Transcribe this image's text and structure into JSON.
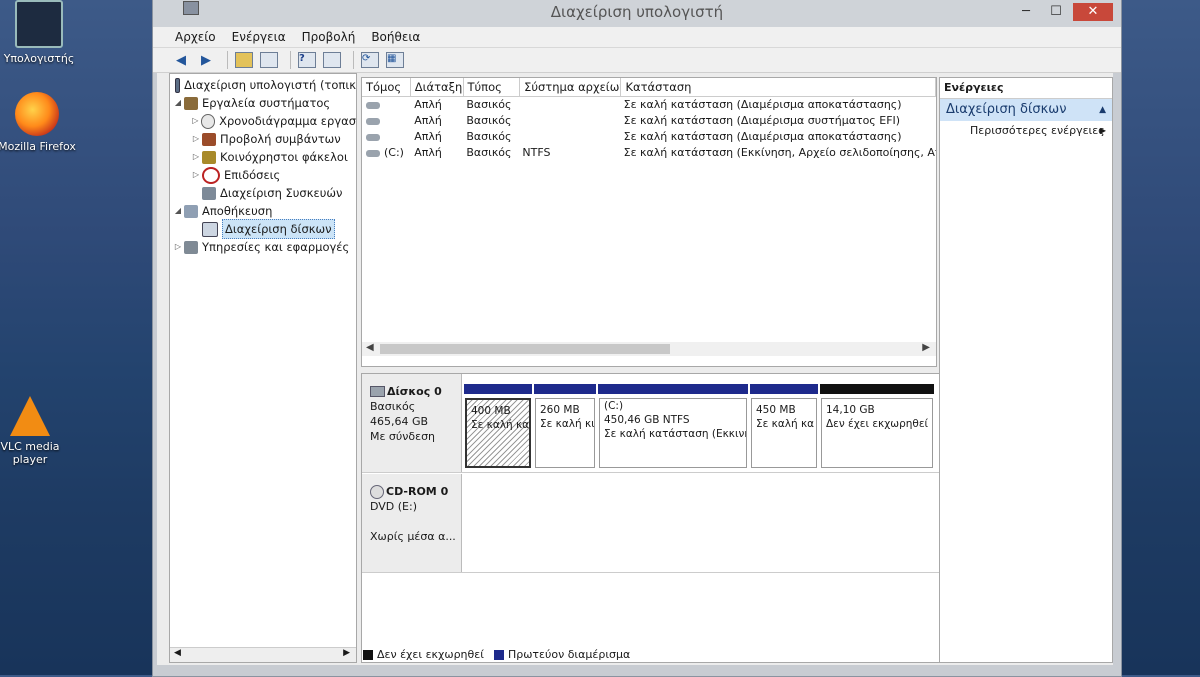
{
  "desktop": {
    "icons": [
      {
        "label": "Υπολογιστής"
      },
      {
        "label": "Mozilla Firefox"
      },
      {
        "label": "VLC media player"
      }
    ]
  },
  "window": {
    "title": "Διαχείριση υπολογιστή",
    "controls": {
      "minimize": "─",
      "maximize": "☐",
      "close": "✕"
    }
  },
  "menu": [
    "Αρχείο",
    "Ενέργεια",
    "Προβολή",
    "Βοήθεια"
  ],
  "tree": {
    "items": [
      {
        "label": "Διαχείριση υπολογιστή (τοπικ",
        "level": 0,
        "arrow": ""
      },
      {
        "label": "Εργαλεία συστήματος",
        "level": 1,
        "arrow": "◢"
      },
      {
        "label": "Χρονοδιάγραμμα εργασ",
        "level": 2,
        "arrow": "▷"
      },
      {
        "label": "Προβολή συμβάντων",
        "level": 2,
        "arrow": "▷"
      },
      {
        "label": "Κοινόχρηστοι φάκελοι",
        "level": 2,
        "arrow": "▷"
      },
      {
        "label": "Επιδόσεις",
        "level": 2,
        "arrow": "▷"
      },
      {
        "label": "Διαχείριση Συσκευών",
        "level": 2,
        "arrow": ""
      },
      {
        "label": "Αποθήκευση",
        "level": 1,
        "arrow": "◢"
      },
      {
        "label": "Διαχείριση δίσκων",
        "level": 2,
        "arrow": ""
      },
      {
        "label": "Υπηρεσίες και εφαρμογές",
        "level": 1,
        "arrow": "▷"
      }
    ]
  },
  "volumes": {
    "headers": [
      "Τόμος",
      "Διάταξη",
      "Τύπος",
      "Σύστημα αρχείων",
      "Κατάσταση"
    ],
    "rows": [
      {
        "volume": "",
        "layout": "Απλή",
        "type": "Βασικός",
        "fs": "",
        "status": "Σε καλή κατάσταση (Διαμέρισμα αποκατάστασης)"
      },
      {
        "volume": "",
        "layout": "Απλή",
        "type": "Βασικός",
        "fs": "",
        "status": "Σε καλή κατάσταση (Διαμέρισμα συστήματος EFI)"
      },
      {
        "volume": "",
        "layout": "Απλή",
        "type": "Βασικός",
        "fs": "",
        "status": "Σε καλή κατάσταση (Διαμέρισμα αποκατάστασης)"
      },
      {
        "volume": "(C:)",
        "layout": "Απλή",
        "type": "Βασικός",
        "fs": "NTFS",
        "status": "Σε καλή κατάσταση (Εκκίνηση, Αρχείο σελιδοποίησης, Αποτύ"
      }
    ]
  },
  "disks": [
    {
      "name": "Δίσκος 0",
      "type": "Βασικός",
      "size": "465,64 GB",
      "state": "Με σύνδεση",
      "partitions": [
        {
          "label": "",
          "size": "400 MB",
          "status": "Σε καλή κα",
          "kind": "primary"
        },
        {
          "label": "",
          "size": "260 MB",
          "status": "Σε καλή κι",
          "kind": "primary"
        },
        {
          "label": "(C:)",
          "size": "450,46 GB NTFS",
          "status": "Σε καλή κατάσταση (Εκκινη",
          "kind": "primary"
        },
        {
          "label": "",
          "size": "450 MB",
          "status": "Σε καλή κα",
          "kind": "primary"
        },
        {
          "label": "",
          "size": "14,10 GB",
          "status": "Δεν έχει εκχωρηθεί",
          "kind": "unallocated"
        }
      ]
    },
    {
      "name": "CD-ROM 0",
      "type": "DVD (E:)",
      "state": "Χωρίς μέσα α..."
    }
  ],
  "legend": [
    {
      "label": "Δεν έχει εκχωρηθεί",
      "color": "#111111"
    },
    {
      "label": "Πρωτεύον διαμέρισμα",
      "color": "#1e2a8c"
    }
  ],
  "actions": {
    "header": "Ενέργειες",
    "section": "Διαχείριση δίσκων",
    "more": "Περισσότερες ενέργειες"
  }
}
